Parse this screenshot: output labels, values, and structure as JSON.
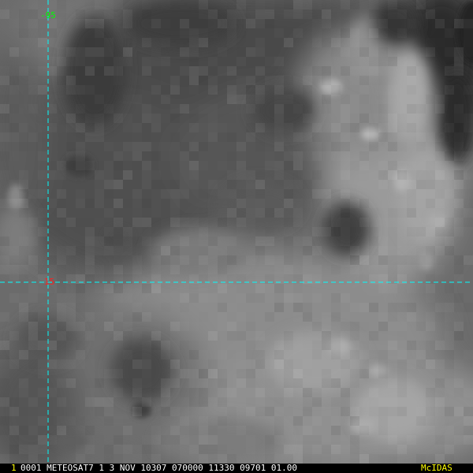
{
  "image": {
    "description_colors": {
      "grid": "#00ffff",
      "lon_label": "#00ff00",
      "lat_label": "#ff2020",
      "frame_number": "#ffff00",
      "system_name": "#ffff00",
      "status_text": "#ffffff"
    }
  },
  "overlay": {
    "longitude_label": "-95",
    "latitude_label": "15"
  },
  "status_bar": {
    "frame_number": "1",
    "text": "0001 METEOSAT7  1   3 NOV 10307 070000 11330 09701 01.00",
    "system_name": "McIDAS"
  }
}
